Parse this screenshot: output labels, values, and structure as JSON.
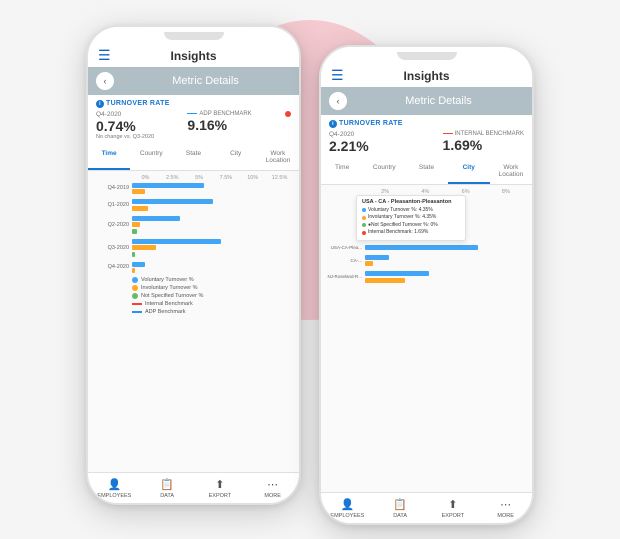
{
  "blob": {},
  "phone1": {
    "appTitle": "Insights",
    "metricDetailsTitle": "Metric Details",
    "backBtn": "‹",
    "sectionLabel": "TURNOVER RATE",
    "period": "Q4-2020",
    "periodChange": "No change\nvs. Q3-2020",
    "value": "0.74%",
    "benchmarkLabel": "ADP BENCHMARK",
    "benchmarkDash": "--",
    "benchmarkValue": "9.16%",
    "dotLabel": "0",
    "tabs": [
      "Time",
      "Country",
      "State",
      "City",
      "Work Location"
    ],
    "activeTab": "Time",
    "chartAxisLabels": [
      "0%",
      "2.5%",
      "5%",
      "7.5%",
      "10%",
      "12.5%"
    ],
    "chartRows": [
      {
        "label": "Q4-2019",
        "blue": 45,
        "orange": 8,
        "green": 0
      },
      {
        "label": "Q1-2020",
        "blue": 50,
        "orange": 10,
        "green": 0
      },
      {
        "label": "Q2-2020",
        "blue": 30,
        "orange": 5,
        "green": 3
      },
      {
        "label": "Q3-2020",
        "blue": 55,
        "orange": 15,
        "green": 2
      },
      {
        "label": "Q4-2020",
        "blue": 8,
        "orange": 2,
        "green": 0
      }
    ],
    "legend": [
      {
        "type": "dot",
        "color": "#42a5f5",
        "label": "Voluntary Turnover %"
      },
      {
        "type": "dot",
        "color": "#ffa726",
        "label": "Involuntary Turnover %"
      },
      {
        "type": "dot",
        "color": "#66bb6a",
        "label": "Not Specified Turnover %"
      },
      {
        "type": "line",
        "color": "#f44336",
        "label": "Internal Benchmark"
      },
      {
        "type": "line",
        "color": "#2196f3",
        "label": "ADP Benchmark"
      }
    ],
    "nav": [
      "EMPLOYEES",
      "DATA",
      "EXPORT",
      "MORE"
    ],
    "navIcons": [
      "👤",
      "📊",
      "⬆",
      "⋯"
    ]
  },
  "phone2": {
    "appTitle": "Insights",
    "metricDetailsTitle": "Metric Details",
    "backBtn": "‹",
    "sectionLabel": "TURNOVER RATE",
    "period": "Q4-2020",
    "value": "2.21%",
    "benchmarkLabel": "INTERNAL BENCHMARK",
    "benchmarkValue": "1.69%",
    "tabs": [
      "Time",
      "Country",
      "State",
      "City",
      "Work Location"
    ],
    "activeTab": "City",
    "chartAxisLabels": [
      "2%",
      "4%",
      "6%",
      "8%"
    ],
    "chartRows": [
      {
        "label": "USA - CA - Plea...",
        "blue": 70,
        "orange": 0,
        "green": 0
      },
      {
        "label": "CA - ...",
        "blue": 15,
        "orange": 5,
        "green": 0
      },
      {
        "label": "NJ - Roseland-R...",
        "blue": 40,
        "orange": 25,
        "green": 0
      }
    ],
    "tooltip": {
      "title": "USA - CA - Pleasanton-Pleasanton",
      "rows": [
        {
          "color": "#42a5f5",
          "label": "Voluntary Turnover %: 4.35%"
        },
        {
          "color": "#ffa726",
          "label": "Involuntary Turnover %: 4.35%"
        },
        {
          "color": "#66bb6a",
          "label": "Not Specified Turnover %: 0%"
        },
        {
          "color": "#f44336",
          "label": "Internal Benchmark: 1.69%"
        }
      ]
    },
    "nav": [
      "EMPLOYEES",
      "DATA",
      "EXPORT",
      "MORE"
    ],
    "navIcons": [
      "👤",
      "📊",
      "⬆",
      "⋯"
    ]
  }
}
